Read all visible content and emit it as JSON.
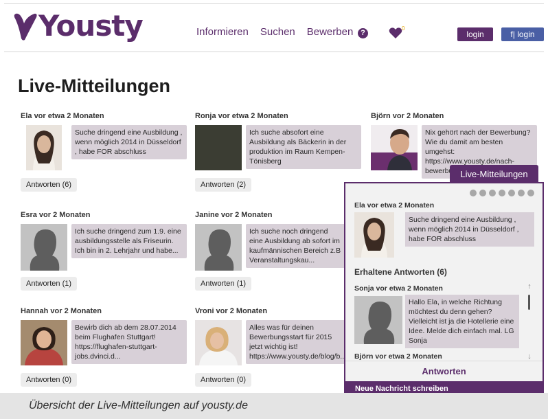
{
  "header": {
    "logo_text": "Yousty",
    "nav": [
      "Informieren",
      "Suchen",
      "Bewerben"
    ],
    "help_label": "?",
    "heart_count": "0",
    "login_label": "login",
    "fb_login_label": "f| login"
  },
  "page_title": "Live-Mitteilungen",
  "cards": [
    {
      "author": "Ela vor etwa 2 Monaten",
      "text": "Suche dringend eine Ausbildung , wenn möglich 2014 in Düsseldorf , habe FOR abschluss",
      "reply": "Antworten (6)"
    },
    {
      "author": "Ronja vor etwa 2 Monaten",
      "text": "Ich suche absofort eine Ausbildung als Bäckerin in der produktion im Raum Kempen-Tönisberg",
      "reply": "Antworten (2)"
    },
    {
      "author": "Björn vor 2 Monaten",
      "text": "Nix gehört nach der Bewerbung? Wie du damit am besten umgehst: https://www.yousty.de/nach-bewerbu...",
      "reply": ""
    },
    {
      "author": "Esra vor 2 Monaten",
      "text": "Ich suche dringend zum 1.9. eine ausbildungsstelle als Friseurin. Ich bin in 2. Lehrjahr und habe...",
      "reply": "Antworten (1)"
    },
    {
      "author": "Janine vor 2 Monaten",
      "text": "Ich suche noch dringend eine Ausbildung ab sofort im kaufmännischen Bereich z.B Veranstaltungskau...",
      "reply": "Antworten (1)"
    },
    {
      "author": "Hannah vor 2 Monaten",
      "text": "Bewirb dich ab dem 28.07.2014 beim Flughafen Stuttgart! https://flughafen-stuttgart-jobs.dvinci.d...",
      "reply": "Antworten (0)"
    },
    {
      "author": "Vroni vor 2 Monaten",
      "text": "Alles was für deinen Bewerbungsstart für 2015 jetzt wichtig ist! https://www.yousty.de/blog/b...",
      "reply": "Antworten (0)"
    }
  ],
  "panel": {
    "tab_label": "Live-Mitteilungen",
    "author": "Ela vor etwa 2 Monaten",
    "text": "Suche dringend eine Ausbildung , wenn möglich 2014 in Düsseldorf , habe FOR abschluss",
    "received": "Erhaltene Antworten (6)",
    "reply_author": "Sonja vor etwa 2 Monaten",
    "reply_text": "Hallo Ela, in welche Richtung möchtest du denn gehen? Vielleicht ist ja die Hotellerie eine Idee. Melde dich einfach mal. LG Sonja",
    "next_author": "Björn vor etwa 2 Monaten",
    "answer_label": "Antworten",
    "footer_label": "Neue Nachricht schreiben",
    "scroll_up": "↑",
    "scroll_down": "↓"
  },
  "caption": "Übersicht der Live-Mitteilungen auf yousty.de",
  "colors": {
    "brand": "#5b2d6b",
    "facebook": "#4a5fa5",
    "bubble": "#d8d0d8"
  }
}
